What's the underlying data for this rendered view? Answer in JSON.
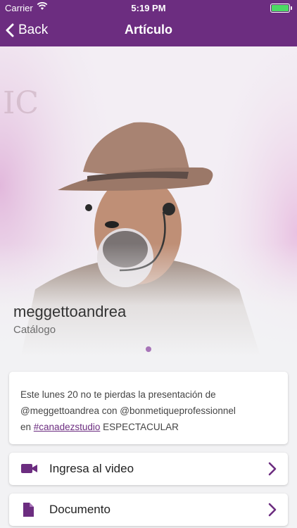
{
  "status_bar": {
    "carrier": "Carrier",
    "time": "5:19 PM",
    "battery_color": "#4cd964"
  },
  "nav": {
    "back_label": "Back",
    "title": "Artículo",
    "color": "#6c2d80"
  },
  "hero": {
    "name": "meggettoandrea",
    "subtitle": "Catálogo",
    "page_indicator": {
      "current": 1,
      "total": 1
    }
  },
  "description": {
    "line1": "Este lunes 20 no te pierdas la presentación de",
    "line2": "@meggettoandrea con @bonmetiqueprofessionnel",
    "line3_prefix": "en ",
    "hashtag": "#canadezstudio",
    "line3_suffix": " ESPECTACULAR"
  },
  "actions": [
    {
      "label": "Ingresa al video",
      "icon": "video-camera-icon"
    },
    {
      "label": "Documento",
      "icon": "document-icon"
    }
  ],
  "accent_color": "#6c2d80"
}
